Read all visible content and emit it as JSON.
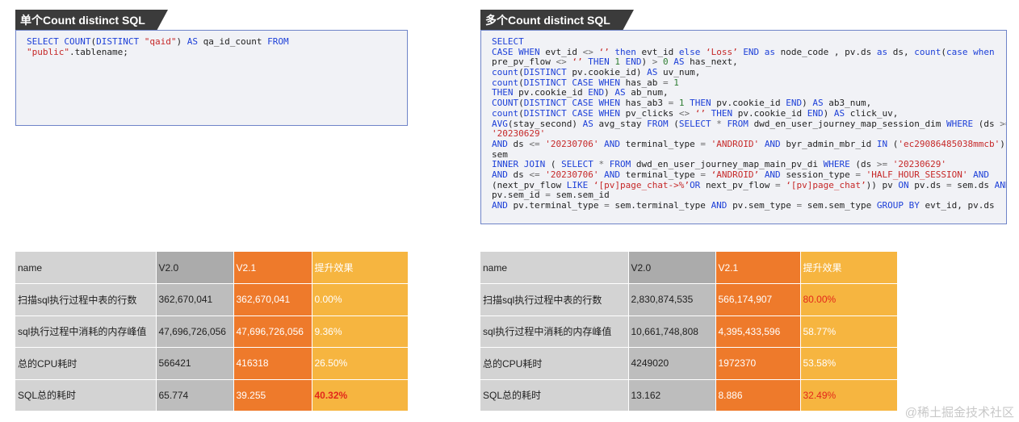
{
  "left": {
    "title": "单个Count distinct SQL",
    "code": [
      [
        [
          "kw",
          "SELECT "
        ],
        [
          "fn",
          "COUNT"
        ],
        [
          "t",
          "("
        ],
        [
          "kw",
          "DISTINCT "
        ],
        [
          "str",
          "\"qaid\""
        ],
        [
          "t",
          ") "
        ],
        [
          "kw",
          "AS "
        ],
        [
          "t",
          "qa_id_count "
        ],
        [
          "kw",
          "FROM"
        ]
      ],
      [
        [
          "str",
          "\"public\""
        ],
        [
          "t",
          ".tablename;"
        ]
      ]
    ],
    "table": {
      "headers": [
        "name",
        "V2.0",
        "V2.1",
        "提升效果"
      ],
      "rows": [
        [
          "扫描sql执行过程中表的行数",
          "362,670,041",
          "362,670,041",
          "0.00%"
        ],
        [
          "sql执行过程中消耗的内存峰值",
          "47,696,726,056",
          "47,696,726,056",
          "9.36%"
        ],
        [
          "总的CPU耗时",
          "566421",
          "416318",
          "26.50%"
        ],
        [
          "SQL总的耗时",
          "65.774",
          "39.255",
          "40.32%"
        ]
      ]
    }
  },
  "right": {
    "title": "多个Count distinct SQL",
    "code": [
      [
        [
          "kw",
          "SELECT"
        ]
      ],
      [
        [
          "kw",
          "CASE WHEN "
        ],
        [
          "t",
          "evt_id "
        ],
        [
          "op",
          "<> "
        ],
        [
          "str",
          "‘’ "
        ],
        [
          "kw",
          "then "
        ],
        [
          "t",
          "evt_id "
        ],
        [
          "kw",
          "else "
        ],
        [
          "str",
          "‘Loss’ "
        ],
        [
          "kw",
          "END as "
        ],
        [
          "t",
          "node_code , pv.ds "
        ],
        [
          "kw",
          "as "
        ],
        [
          "t",
          "ds, "
        ],
        [
          "fn",
          "count"
        ],
        [
          "t",
          "("
        ],
        [
          "kw",
          "case when"
        ]
      ],
      [
        [
          "t",
          "pre_pv_flow "
        ],
        [
          "op",
          "<> "
        ],
        [
          "str",
          "‘’ "
        ],
        [
          "kw",
          "THEN "
        ],
        [
          "num",
          "1 "
        ],
        [
          "kw",
          "END"
        ],
        [
          "t",
          ") "
        ],
        [
          "op",
          "> "
        ],
        [
          "num",
          "0 "
        ],
        [
          "kw",
          "AS "
        ],
        [
          "t",
          "has_next,"
        ]
      ],
      [
        [
          "fn",
          "count"
        ],
        [
          "t",
          "("
        ],
        [
          "kw",
          "DISTINCT "
        ],
        [
          "t",
          "pv.cookie_id) "
        ],
        [
          "kw",
          "AS "
        ],
        [
          "t",
          "uv_num,"
        ]
      ],
      [
        [
          "fn",
          "count"
        ],
        [
          "t",
          "("
        ],
        [
          "kw",
          "DISTINCT CASE WHEN "
        ],
        [
          "t",
          "has_ab "
        ],
        [
          "op",
          "= "
        ],
        [
          "num",
          "1"
        ]
      ],
      [
        [
          "kw",
          "THEN "
        ],
        [
          "t",
          "pv.cookie_id "
        ],
        [
          "kw",
          "END"
        ],
        [
          "t",
          ") "
        ],
        [
          "kw",
          "AS "
        ],
        [
          "t",
          "ab_num,"
        ]
      ],
      [
        [
          "fn",
          "COUNT"
        ],
        [
          "t",
          "("
        ],
        [
          "kw",
          "DISTINCT CASE WHEN "
        ],
        [
          "t",
          "has_ab3 "
        ],
        [
          "op",
          "= "
        ],
        [
          "num",
          "1 "
        ],
        [
          "kw",
          "THEN "
        ],
        [
          "t",
          "pv.cookie_id "
        ],
        [
          "kw",
          "END"
        ],
        [
          "t",
          ") "
        ],
        [
          "kw",
          "AS "
        ],
        [
          "t",
          "ab3_num,"
        ]
      ],
      [
        [
          "fn",
          "count"
        ],
        [
          "t",
          "("
        ],
        [
          "kw",
          "DISTINCT CASE WHEN "
        ],
        [
          "t",
          "pv_clicks "
        ],
        [
          "op",
          "<> "
        ],
        [
          "str",
          "‘’ "
        ],
        [
          "kw",
          "THEN "
        ],
        [
          "t",
          "pv.cookie_id "
        ],
        [
          "kw",
          "END"
        ],
        [
          "t",
          ") "
        ],
        [
          "kw",
          "AS "
        ],
        [
          "t",
          "click_uv,"
        ]
      ],
      [
        [
          "fn",
          "AVG"
        ],
        [
          "t",
          "(stay_second) "
        ],
        [
          "kw",
          "AS "
        ],
        [
          "t",
          "avg_stay "
        ],
        [
          "kw",
          "FROM "
        ],
        [
          "t",
          "("
        ],
        [
          "kw",
          "SELECT "
        ],
        [
          "op",
          "* "
        ],
        [
          "kw",
          "FROM "
        ],
        [
          "t",
          "dwd_en_user_journey_map_session_dim "
        ],
        [
          "kw",
          "WHERE "
        ],
        [
          "t",
          "(ds "
        ],
        [
          "op",
          ">="
        ]
      ],
      [
        [
          "str",
          "'20230629'"
        ]
      ],
      [
        [
          "kw",
          "AND "
        ],
        [
          "t",
          "ds "
        ],
        [
          "op",
          "<= "
        ],
        [
          "str",
          "'20230706' "
        ],
        [
          "kw",
          "AND "
        ],
        [
          "t",
          "terminal_type "
        ],
        [
          "op",
          "= "
        ],
        [
          "str",
          "'ANDROID' "
        ],
        [
          "kw",
          "AND "
        ],
        [
          "t",
          "byr_admin_mbr_id "
        ],
        [
          "kw",
          "IN "
        ],
        [
          "t",
          "("
        ],
        [
          "str",
          "'ec29086485038mmcb'"
        ],
        [
          "t",
          ")))"
        ]
      ],
      [
        [
          "t",
          "sem"
        ]
      ],
      [
        [
          "kw",
          "INNER JOIN "
        ],
        [
          "t",
          "( "
        ],
        [
          "kw",
          "SELECT "
        ],
        [
          "op",
          "* "
        ],
        [
          "kw",
          "FROM "
        ],
        [
          "t",
          "dwd_en_user_journey_map_main_pv_di "
        ],
        [
          "kw",
          "WHERE "
        ],
        [
          "t",
          "(ds "
        ],
        [
          "op",
          ">= "
        ],
        [
          "str",
          "'20230629'"
        ]
      ],
      [
        [
          "kw",
          "AND "
        ],
        [
          "t",
          "ds "
        ],
        [
          "op",
          "<= "
        ],
        [
          "str",
          "'20230706' "
        ],
        [
          "kw",
          "AND "
        ],
        [
          "t",
          "terminal_type "
        ],
        [
          "op",
          "= "
        ],
        [
          "str",
          "‘ANDROID’ "
        ],
        [
          "kw",
          "AND "
        ],
        [
          "t",
          "session_type "
        ],
        [
          "op",
          "= "
        ],
        [
          "str",
          "'HALF_HOUR_SESSION' "
        ],
        [
          "kw",
          "AND"
        ]
      ],
      [
        [
          "t",
          "(next_pv_flow "
        ],
        [
          "kw",
          "LIKE "
        ],
        [
          "str",
          "‘[pv]page_chat->%’"
        ],
        [
          "kw",
          "OR "
        ],
        [
          "t",
          "next_pv_flow "
        ],
        [
          "op",
          "= "
        ],
        [
          "str",
          "‘[pv]page_chat’"
        ],
        [
          "t",
          ")) pv "
        ],
        [
          "kw",
          "ON "
        ],
        [
          "t",
          "pv.ds "
        ],
        [
          "op",
          "= "
        ],
        [
          "t",
          "sem.ds "
        ],
        [
          "kw",
          "AND"
        ]
      ],
      [
        [
          "t",
          "pv.sem_id "
        ],
        [
          "op",
          "= "
        ],
        [
          "t",
          "sem.sem_id"
        ]
      ],
      [
        [
          "kw",
          "AND "
        ],
        [
          "t",
          "pv.terminal_type "
        ],
        [
          "op",
          "= "
        ],
        [
          "t",
          "sem.terminal_type "
        ],
        [
          "kw",
          "AND "
        ],
        [
          "t",
          "pv.sem_type "
        ],
        [
          "op",
          "= "
        ],
        [
          "t",
          "sem.sem_type "
        ],
        [
          "kw",
          "GROUP BY "
        ],
        [
          "t",
          "evt_id, pv.ds"
        ]
      ]
    ],
    "table": {
      "headers": [
        "name",
        "V2.0",
        "V2.1",
        "提升效果"
      ],
      "rows": [
        [
          "扫描sql执行过程中表的行数",
          "2,830,874,535",
          "566,174,907",
          "80.00%"
        ],
        [
          "sql执行过程中消耗的内存峰值",
          "10,661,748,808",
          "4,395,433,596",
          "58.77%"
        ],
        [
          "总的CPU耗时",
          "4249020",
          "1972370",
          "53.58%"
        ],
        [
          "SQL总的耗时",
          "13.162",
          "8.886",
          "32.49%"
        ]
      ]
    }
  },
  "watermark": "@稀土掘金技术社区",
  "colors": {
    "tab_bg": "#3b3b3b",
    "code_bg": "#f1f2f6",
    "code_border": "#6f84c8",
    "keyword": "#1c3fd8",
    "string": "#c62828",
    "number": "#2e7d32",
    "name_col": "#d3d3d3",
    "v20_col": "#bdbdbd",
    "v21_col": "#ee7a2b",
    "improve_col": "#f6b540",
    "highlight_text": "#e3281b"
  }
}
